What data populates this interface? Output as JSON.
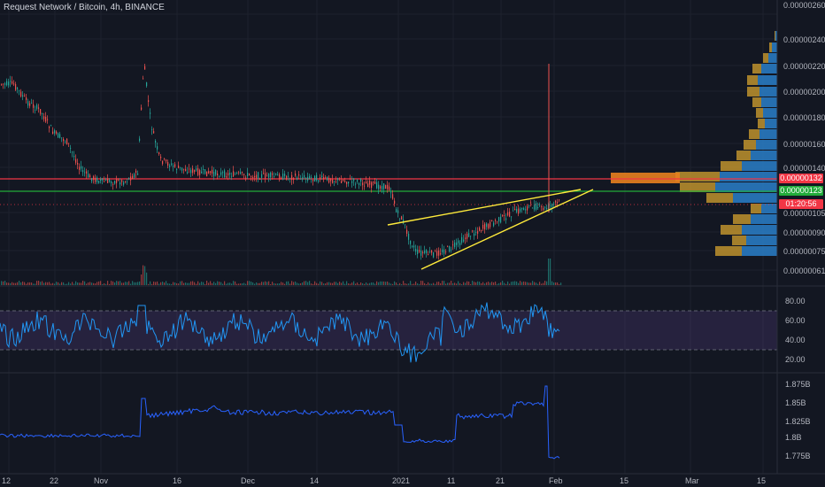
{
  "header": {
    "title": "Request Network / Bitcoin, 4h, BINANCE"
  },
  "price_axis": {
    "ticks": [
      "0.00000260",
      "0.00000240",
      "0.00000220",
      "0.00000200",
      "0.00000180",
      "0.00000160",
      "0.00000140",
      "0.00000105",
      "0.00000090",
      "0.00000075",
      "0.00000061"
    ],
    "tags": {
      "red_level": "0.00000132",
      "green_level": "0.00000123",
      "countdown": "01:20:56"
    }
  },
  "rsi_axis": {
    "ticks": [
      "80.00",
      "60.00",
      "40.00",
      "20.00"
    ]
  },
  "indicator_axis": {
    "ticks": [
      "1.875B",
      "1.85B",
      "1.825B",
      "1.8B",
      "1.775B"
    ]
  },
  "time_axis": {
    "labels": [
      "12",
      "22",
      "Nov",
      "16",
      "Dec",
      "14",
      "2021",
      "11",
      "21",
      "Feb",
      "15",
      "Mar",
      "15"
    ]
  },
  "colors": {
    "background": "#131722",
    "up_candle": "#26a69a",
    "down_candle": "#ef5350",
    "resistance_line": "#f23645",
    "support_line": "#22ab3a",
    "wedge_lines": "#ffeb3b",
    "rsi_line": "#2196f3",
    "rsi_band": "#7e57c2",
    "volume_profile_up": "#2a7fc9",
    "volume_profile_down": "#c99a2e"
  }
}
